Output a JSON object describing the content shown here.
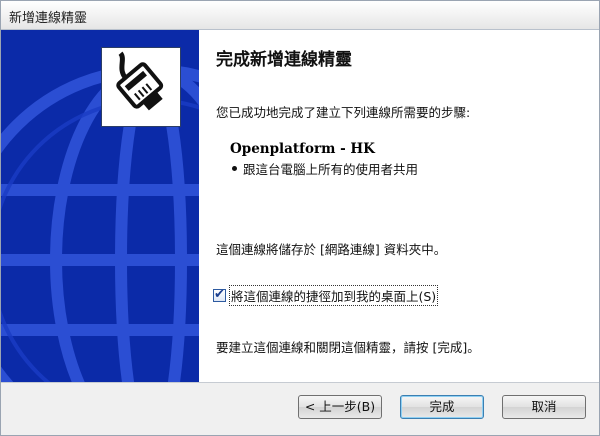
{
  "window": {
    "title": "新增連線精靈"
  },
  "sidepanel": {
    "icon": "network-cable-icon",
    "background_color": "#0b2aa8",
    "graphic": "globe-watermark"
  },
  "main": {
    "heading": "完成新增連線精靈",
    "intro": "您已成功地完成了建立下列連線所需要的步驟:",
    "connection_name": "Openplatform - HK",
    "connection_detail": "跟這台電腦上所有的使用者共用",
    "saved_note": "這個連線將儲存於 [網路連線] 資料夾中。",
    "shortcut_checkbox": {
      "label": "將這個連線的捷徑加到我的桌面上(S)",
      "checked": true,
      "check_glyph": "✔"
    },
    "finish_note": "要建立這個連線和關閉這個精靈，請按 [完成]。"
  },
  "footer": {
    "back_label": "< 上一步(B)",
    "finish_label": "完成",
    "cancel_label": "取消"
  }
}
